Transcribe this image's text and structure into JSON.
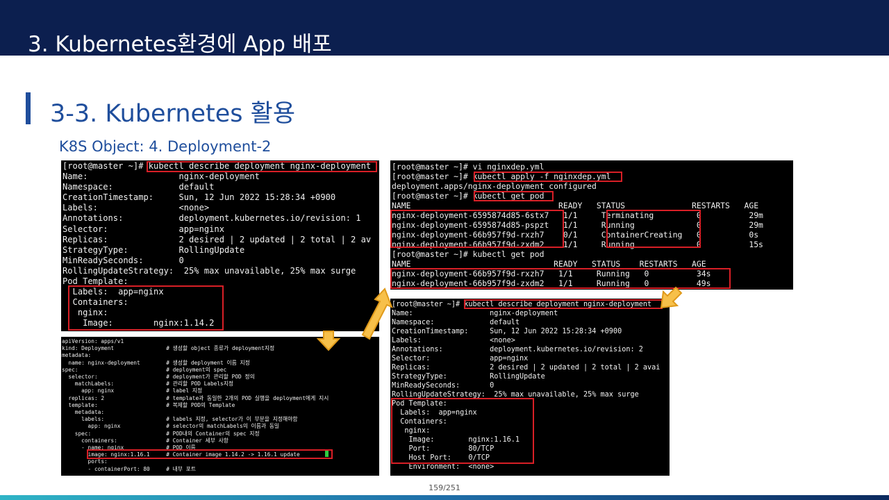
{
  "header": {
    "title": "3.  Kubernetes환경에 App 배포"
  },
  "section": {
    "title": "3-3. Kubernetes 활용",
    "subtitle": "K8S Object: 4. Deployment-2"
  },
  "terminal1": {
    "text": "[root@master ~]# kubectl describe deployment nginx-deployment\nName:                  nginx-deployment\nNamespace:             default\nCreationTimestamp:     Sun, 12 Jun 2022 15:28:34 +0900\nLabels:                <none>\nAnnotations:           deployment.kubernetes.io/revision: 1\nSelector:              app=nginx\nReplicas:              2 desired | 2 updated | 2 total | 2 av\nStrategyType:          RollingUpdate\nMinReadySeconds:       0\nRollingUpdateStrategy:  25% max unavailable, 25% max surge\nPod Template:\n  Labels:  app=nginx\n  Containers:\n   nginx:\n    Image:        nginx:1.14.2"
  },
  "terminal2": {
    "text": "apiVersion: apps/v1\nkind: Deployment                # 생성할 object 종류가 deployment지정\nmetadata:\n  name: nginx-deployment        # 생성할 deployment 이름 지정\nspec:                           # deployment의 spec\n  selector:                     # deployment가 관리할 POD 정의\n    matchLabels:                # 관리할 POD Labels지정\n      app: nginx                # label 지정\n  replicas: 2                   # template과 동일한 2개의 POD 실행을 deployment에게 지시\n  template:                     # 복제할 POD의 Template\n    metadata:\n      labels:                   # labels 지정, selector가 이 부분을 지정해야함\n        app: nginx              # selector의 matchLabels의 이름과 동일\n    spec:                       # POD내의 Container의 spec 지정\n      containers:               # Container 세부 사항\n      - name: nginx             # POD 이름\n        image: nginx:1.16.1     # Container image 1.14.2 -> 1.16.1 update\n        ports:\n        - containerPort: 80     # 내부 포트"
  },
  "terminal3": {
    "text": "[root@master ~]# vi nginxdep.yml\n[root@master ~]# kubectl apply -f nginxdep.yml\ndeployment.apps/nginx-deployment configured\n[root@master ~]# kubectl get pod\nNAME                               READY   STATUS              RESTARTS   AGE\nnginx-deployment-6595874d85-6stx7   1/1     Terminating         0          29m\nnginx-deployment-6595874d85-pspzt   1/1     Running             0          29m\nnginx-deployment-66b957f9d-rxzh7    0/1     ContainerCreating   0          0s\nnginx-deployment-66b957f9d-zxdm2    1/1     Running             0          15s\n[root@master ~]# kubectl get pod\nNAME                              READY   STATUS    RESTARTS   AGE\nnginx-deployment-66b957f9d-rxzh7   1/1     Running   0          34s\nnginx-deployment-66b957f9d-zxdm2   1/1     Running   0          49s"
  },
  "terminal4": {
    "text": "[root@master ~]# kubectl describe deployment nginx-deployment\nName:                  nginx-deployment\nNamespace:             default\nCreationTimestamp:     Sun, 12 Jun 2022 15:28:34 +0900\nLabels:                <none>\nAnnotations:           deployment.kubernetes.io/revision: 2\nSelector:              app=nginx\nReplicas:              2 desired | 2 updated | 2 total | 2 avai\nStrategyType:          RollingUpdate\nMinReadySeconds:       0\nRollingUpdateStrategy:  25% max unavailable, 25% max surge\nPod Template:\n  Labels:  app=nginx\n  Containers:\n   nginx:\n    Image:        nginx:1.16.1\n    Port:         80/TCP\n    Host Port:    0/TCP\n    Environment:  <none>"
  },
  "footer": {
    "page": "159/251"
  },
  "colors": {
    "header_bg": "#0c1f4f",
    "accent": "#1f4e9c",
    "highlight": "#d81f26",
    "arrow_fill": "#f7c04a",
    "arrow_stroke": "#e09a1a"
  },
  "icons": [
    "arrow-down-icon",
    "arrow-up-right-icon",
    "arrow-down-left-icon"
  ]
}
